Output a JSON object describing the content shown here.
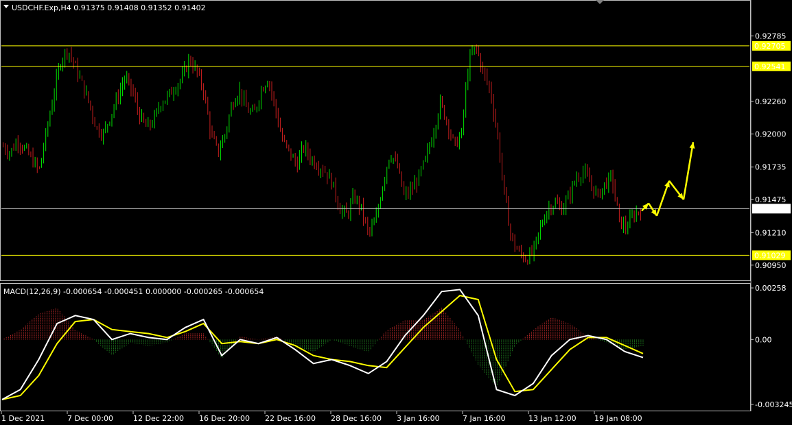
{
  "header": {
    "symbol_line": "USDCHF.Exp,H4  0.91375 0.91408 0.91352 0.91402"
  },
  "macd_header": "MACD(12,26,9) -0.000654 -0.000451 0.000000 -0.000265 -0.000654",
  "colors": {
    "background": "#000000",
    "bull": "#00e000",
    "bear": "#c81e1e",
    "hline": "#ffff00",
    "price_line": "#c0c0c0",
    "macd_main": "#ffffff",
    "macd_signal": "#ffff00",
    "hist_pos": "#b42828",
    "hist_neg": "#1e7a1e",
    "arrow": "#ffff00"
  },
  "chart_data": [
    {
      "type": "candlestick",
      "symbol": "USDCHF.Exp",
      "timeframe": "H4",
      "ylim": [
        0.9085,
        0.9305
      ],
      "price_ticks": [
        "0.92785",
        "0.92260",
        "0.92000",
        "0.91735",
        "0.91475",
        "0.91210",
        "0.90950"
      ],
      "horizontal_levels": [
        {
          "value": 0.92705,
          "label": "0.92705",
          "kind": "resistance"
        },
        {
          "value": 0.92541,
          "label": "0.92541",
          "kind": "resistance"
        },
        {
          "value": 0.91402,
          "label": "0.91402",
          "kind": "current-price"
        },
        {
          "value": 0.91029,
          "label": "0.91029",
          "kind": "support"
        }
      ],
      "time_labels": [
        "1 Dec 2021",
        "7 Dec 00:00",
        "12 Dec 22:00",
        "16 Dec 20:00",
        "22 Dec 16:00",
        "28 Dec 16:00",
        "3 Jan 16:00",
        "7 Jan 16:00",
        "13 Jan 12:00",
        "19 Jan 08:00"
      ],
      "price_path": [
        0.919,
        0.9185,
        0.9195,
        0.9188,
        0.918,
        0.917,
        0.92,
        0.923,
        0.9258,
        0.9268,
        0.9255,
        0.924,
        0.9225,
        0.9205,
        0.92,
        0.9215,
        0.923,
        0.9245,
        0.9235,
        0.9215,
        0.9205,
        0.921,
        0.9225,
        0.923,
        0.9238,
        0.9245,
        0.926,
        0.925,
        0.9235,
        0.92,
        0.9185,
        0.92,
        0.9225,
        0.9235,
        0.922,
        0.9215,
        0.9235,
        0.9245,
        0.922,
        0.9195,
        0.9185,
        0.9175,
        0.919,
        0.918,
        0.9175,
        0.917,
        0.916,
        0.914,
        0.9135,
        0.915,
        0.914,
        0.912,
        0.913,
        0.916,
        0.9185,
        0.9175,
        0.915,
        0.9155,
        0.9165,
        0.918,
        0.92,
        0.9225,
        0.921,
        0.919,
        0.92,
        0.9258,
        0.927,
        0.925,
        0.9235,
        0.92,
        0.915,
        0.9115,
        0.9105,
        0.91,
        0.9105,
        0.9125,
        0.914,
        0.9145,
        0.914,
        0.915,
        0.9165,
        0.917,
        0.916,
        0.915,
        0.916,
        0.9165,
        0.913,
        0.9125,
        0.9135,
        0.914
      ],
      "forecast_arrows": [
        [
          0.91385,
          0.91445
        ],
        [
          0.91445,
          0.91345
        ],
        [
          0.91345,
          0.91625
        ],
        [
          0.91625,
          0.91475
        ],
        [
          0.91475,
          0.91935
        ]
      ]
    },
    {
      "type": "macd",
      "params": "12,26,9",
      "ylim": [
        -0.00345,
        0.00265
      ],
      "ticks": [
        "0.00258",
        "0.00",
        "-0.003245"
      ],
      "main": [
        -0.003,
        -0.0025,
        -0.001,
        0.0008,
        0.0012,
        0.001,
        0.0,
        0.0003,
        0.0001,
        0.0,
        0.0006,
        0.001,
        -0.0008,
        0.0,
        -0.0002,
        0.0001,
        -0.0005,
        -0.0012,
        -0.001,
        -0.0013,
        -0.0017,
        -0.0011,
        0.0002,
        0.0012,
        0.0024,
        0.0025,
        0.0012,
        -0.0025,
        -0.0028,
        -0.0022,
        -0.0008,
        0.0,
        0.0002,
        0.0,
        -0.0006,
        -0.0009
      ],
      "signal": [
        -0.003,
        -0.0028,
        -0.0018,
        -0.0002,
        0.0009,
        0.001,
        0.0005,
        0.0004,
        0.0003,
        0.0001,
        0.0004,
        0.0008,
        -0.0002,
        -0.0001,
        -0.0002,
        0.0,
        -0.0003,
        -0.0008,
        -0.001,
        -0.0011,
        -0.0013,
        -0.0014,
        -0.0004,
        0.0006,
        0.0014,
        0.0022,
        0.002,
        -0.001,
        -0.0026,
        -0.0025,
        -0.0015,
        -0.0005,
        0.0001,
        0.0001,
        -0.0003,
        -0.0007
      ]
    }
  ]
}
